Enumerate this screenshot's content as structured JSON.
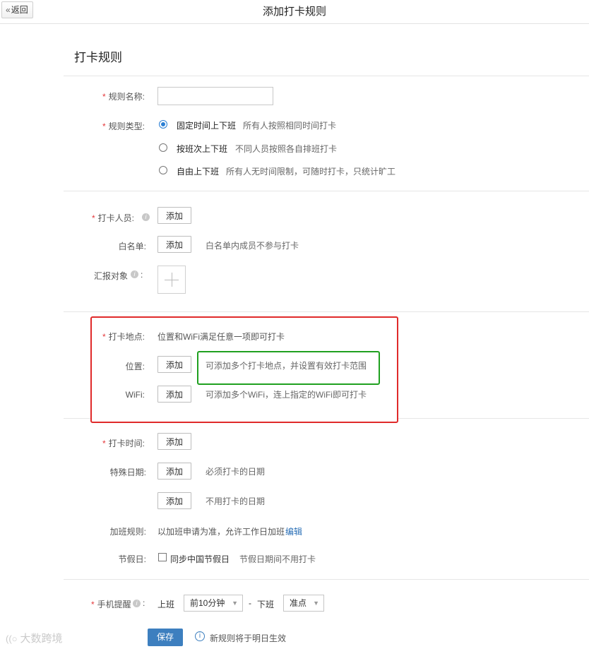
{
  "header": {
    "back_label": "返回",
    "title": "添加打卡规则"
  },
  "section_title": "打卡规则",
  "rule_name": {
    "label": "规则名称:",
    "value": "",
    "placeholder": ""
  },
  "rule_type": {
    "label": "规则类型:",
    "options": [
      {
        "label": "固定时间上下班",
        "desc": "所有人按照相同时间打卡",
        "selected": true
      },
      {
        "label": "按班次上下班",
        "desc": "不同人员按照各自排班打卡",
        "selected": false
      },
      {
        "label": "自由上下班",
        "desc": "所有人无时间限制，可随时打卡，只统计旷工",
        "selected": false
      }
    ]
  },
  "members": {
    "label": "打卡人员:",
    "add_label": "添加"
  },
  "whitelist": {
    "label": "白名单:",
    "add_label": "添加",
    "hint": "白名单内成员不参与打卡"
  },
  "report_to": {
    "label": "汇报对象",
    "plus": "+"
  },
  "location": {
    "label": "打卡地点:",
    "desc": "位置和WiFi满足任意一项即可打卡",
    "position_label": "位置:",
    "position_add": "添加",
    "position_hint": "可添加多个打卡地点，并设置有效打卡范围",
    "wifi_label": "WiFi:",
    "wifi_add": "添加",
    "wifi_hint": "可添加多个WiFi，连上指定的WiFi即可打卡"
  },
  "time": {
    "label": "打卡时间:",
    "add_label": "添加"
  },
  "special_dates": {
    "label": "特殊日期:",
    "must_add": "添加",
    "must_hint": "必须打卡的日期",
    "skip_add": "添加",
    "skip_hint": "不用打卡的日期"
  },
  "overtime": {
    "label": "加班规则:",
    "desc": "以加班申请为准，允许工作日加班",
    "edit_label": "编辑"
  },
  "holiday": {
    "label": "节假日:",
    "checkbox_label": "同步中国节假日",
    "hint": "节假日期间不用打卡",
    "checked": false
  },
  "reminder": {
    "label": "手机提醒",
    "colon": ":",
    "on_label": "上班",
    "on_value": "前10分钟",
    "sep": "-",
    "off_label": "下班",
    "off_value": "准点"
  },
  "footer": {
    "save_label": "保存",
    "notice": "新规则将于明日生效"
  },
  "watermark": "大数跨境",
  "colors": {
    "accent": "#2a7fd4",
    "save_button": "#3d7fbf",
    "red_box": "#e02a2a",
    "green_box": "#1fa01f",
    "required": "#e4393c"
  }
}
